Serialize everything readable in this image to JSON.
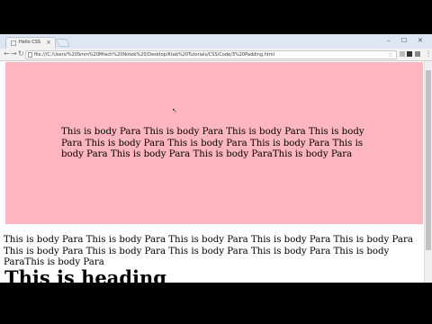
{
  "browser": {
    "tab": {
      "title": "Hello CSS"
    },
    "window_controls": {
      "minimize": "–",
      "maximize": "☐",
      "close": "✕"
    },
    "address_bar": {
      "url": "file:///C:/Users/%20Smm%20Mtech%20Noteb%20/Desktop/Ktab%20Tutorials/CSS/Code/3%20Padding.html"
    }
  },
  "page": {
    "pink_box_text": "This is body Para This is body Para This is body Para This is body Para This is body Para This is body Para This is body Para This is body Para This is body Para This is body ParaThis is body Para",
    "body_para_text": "This is body Para This is body Para This is body Para This is body Para This is body Para This is body Para This is body Para This is body Para This is body Para This is body ParaThis is body Para",
    "heading": "This is heading"
  },
  "colors": {
    "pink_box_background": "#ffb6c1",
    "page_background": "#ffffff",
    "letterbox": "#000000"
  }
}
